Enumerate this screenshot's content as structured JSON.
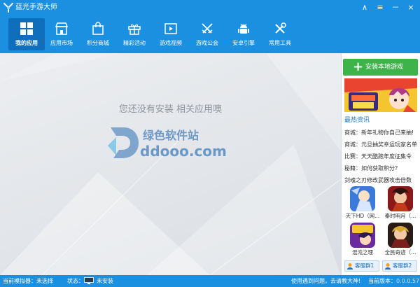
{
  "app": {
    "title": "蓝光手游大师"
  },
  "window_controls": {
    "skin": "∧",
    "menu": "≡",
    "minimize": "－",
    "close": "×"
  },
  "nav": [
    {
      "label": "我的应用",
      "icon": "grid-icon",
      "active": true
    },
    {
      "label": "应用市场",
      "icon": "store-icon"
    },
    {
      "label": "积分商城",
      "icon": "shopping-bag-icon"
    },
    {
      "label": "精彩活动",
      "icon": "gift-icon"
    },
    {
      "label": "游戏视频",
      "icon": "video-icon"
    },
    {
      "label": "游戏公会",
      "icon": "crossed-swords-icon"
    },
    {
      "label": "安卓引擎",
      "icon": "android-icon"
    },
    {
      "label": "常用工具",
      "icon": "tools-icon"
    }
  ],
  "main": {
    "empty_message": "您还没有安装  相关应用噢",
    "watermark_title": "绿色软件站",
    "watermark_url": "ddooo.com"
  },
  "sidebar": {
    "install_button": "安装本地游戏",
    "hot_title": "最热资讯",
    "news": [
      "商城：新年礼物你自己来抽!",
      "商城：元旦抽奖幸运玩家名单",
      "比赛：天天酷跑年度征集令",
      "秘籍：如何获取积分？",
      "剑魂之刃修改武器攻击倍数"
    ],
    "games": [
      {
        "label": "天下HD（网..."
      },
      {
        "label": "秦时明月（..."
      },
      {
        "label": "混沌之理"
      },
      {
        "label": "全民奇迹（..."
      }
    ],
    "group_buttons": [
      "客服群1",
      "客服群2"
    ]
  },
  "status": {
    "emulator_label": "当前模拟器：",
    "emulator_value": "未选择",
    "state_label": "状态：",
    "state_value": "未安装",
    "help_text": "使用遇到问题，去请教大神!",
    "version_label": "当前版本：",
    "version_value": "0.0.0.57"
  },
  "colors": {
    "accent": "#1b8fe0",
    "active_tab": "#0f6fbd",
    "install_green": "#3db34a",
    "hot_title": "#1b7fd4"
  }
}
